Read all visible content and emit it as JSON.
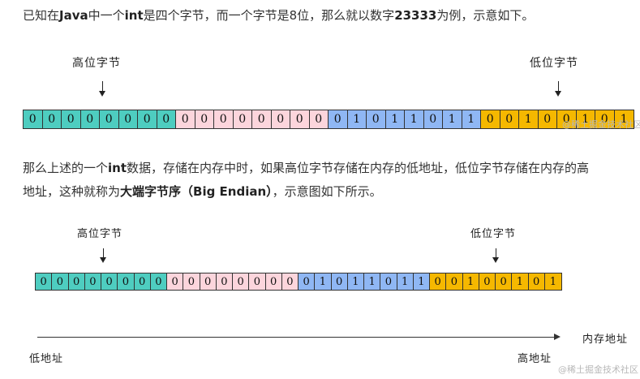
{
  "intro": {
    "p1": "已知在",
    "b1": "Java",
    "p2": "中一个",
    "b2": "int",
    "p3": "是四个字节，而一个字节是8位，那么就以数字",
    "b3": "23333",
    "p4": "为例，示意如下。"
  },
  "diagram1": {
    "high_label": "高位字节",
    "low_label": "低位字节",
    "watermark": "@稀土掘金技术社区"
  },
  "explanation": {
    "line1_a": "那么上述的一个",
    "line1_b": "int",
    "line1_c": "数据，存储在内存中时，如果高位字节存储在内存的低地址，低位字节存储在内存的高",
    "line2_a": "地址，这种就称为",
    "line2_b": "大端字节序（Big Endian）",
    "line2_c": "，示意图如下所示。"
  },
  "diagram2": {
    "high_label": "高位字节",
    "low_label": "低位字节",
    "axis_label": "内存地址",
    "low_address_label": "低地址",
    "high_address_label": "高地址",
    "watermark": "@稀土掘金技术社区"
  },
  "bits": [
    "0",
    "0",
    "0",
    "0",
    "0",
    "0",
    "0",
    "0",
    "0",
    "0",
    "0",
    "0",
    "0",
    "0",
    "0",
    "0",
    "0",
    "1",
    "0",
    "1",
    "1",
    "0",
    "1",
    "1",
    "0",
    "0",
    "1",
    "0",
    "0",
    "1",
    "0",
    "1"
  ],
  "byte_colors": [
    "#4ecdc0",
    "#fcd5dc",
    "#8fb7f4",
    "#f5b800"
  ]
}
